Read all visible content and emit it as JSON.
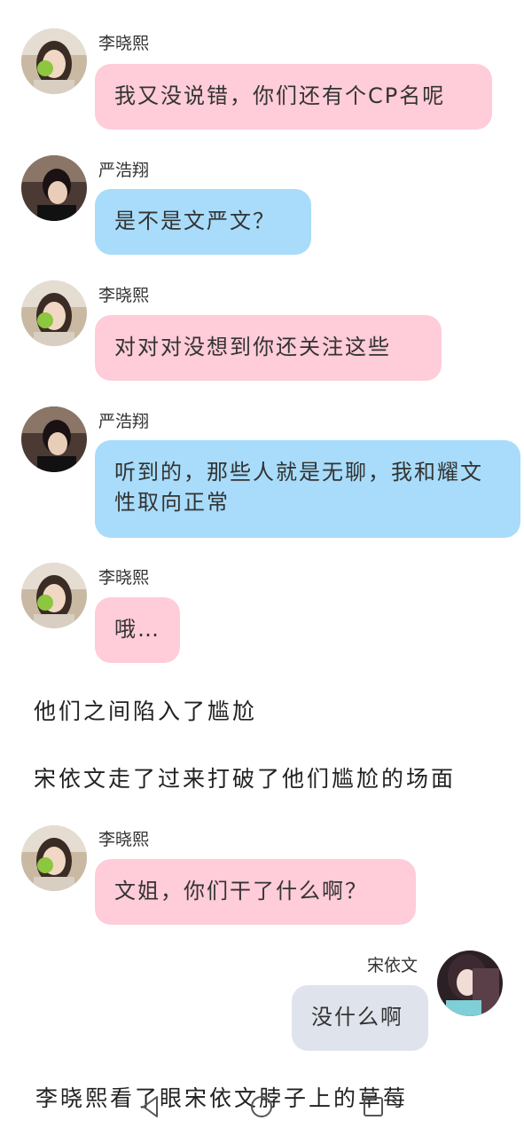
{
  "messages": [
    {
      "sender": "李晓熙",
      "text": "我又没说错，你们还有个CP名呢",
      "side": "left",
      "color": "#ffccd9",
      "avatar": "li-xiaoxi-avatar"
    },
    {
      "sender": "严浩翔",
      "text": "是不是文严文？",
      "side": "left",
      "color": "#a8dcfa",
      "avatar": "yan-haoxiang-avatar"
    },
    {
      "sender": "李晓熙",
      "text": "对对对没想到你还关注这些",
      "side": "left",
      "color": "#ffccd9",
      "avatar": "li-xiaoxi-avatar"
    },
    {
      "sender": "严浩翔",
      "text": "听到的，那些人就是无聊，我和耀文性取向正常",
      "side": "left",
      "color": "#a8dcfa",
      "avatar": "yan-haoxiang-avatar"
    },
    {
      "sender": "李晓熙",
      "text": "哦…",
      "side": "left",
      "color": "#ffccd9",
      "avatar": "li-xiaoxi-avatar"
    },
    {
      "sender": "李晓熙",
      "text": "文姐，你们干了什么啊？",
      "side": "left",
      "color": "#ffccd9",
      "avatar": "li-xiaoxi-avatar"
    },
    {
      "sender": "宋依文",
      "text": "没什么啊",
      "side": "right",
      "color": "#dfe4ec",
      "avatar": "song-yiwen-avatar"
    }
  ],
  "narration": [
    "他们之间陷入了尴尬",
    "宋依文走了过来打破了他们尴尬的场面",
    "李晓熙看了眼宋依文脖子上的草莓"
  ],
  "navbar": {
    "icons": [
      "back-icon",
      "home-icon",
      "recents-icon"
    ]
  }
}
